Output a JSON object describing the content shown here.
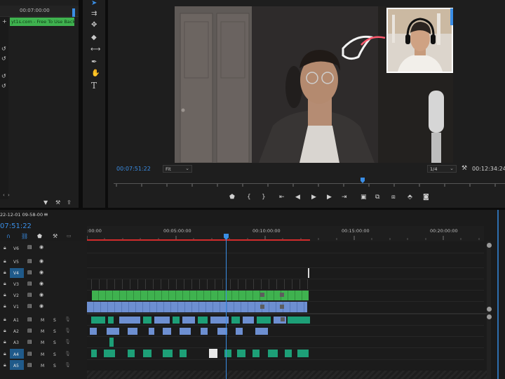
{
  "source_monitor": {
    "timecode": "00:07:00:00",
    "clip_label": "yt1s.com - Free To Use Back"
  },
  "program_monitor": {
    "current_timecode": "00:07:51:22",
    "fit_label": "Fit",
    "resolution_label": "1/4",
    "duration_timecode": "00:12:34:24"
  },
  "timeline": {
    "sequence_name": "22-12-01 09-58-00",
    "menu_icon": "≡",
    "current_timecode": "07:51:22",
    "ruler_labels": [
      ":00:00",
      "00:05:00:00",
      "00:10:00:00",
      "00:15:00:00",
      "00:20:00:00"
    ],
    "video_tracks": [
      "V6",
      "V5",
      "V4",
      "V3",
      "V2",
      "V1"
    ],
    "audio_tracks": [
      "A1",
      "A2",
      "A3",
      "A4",
      "A5"
    ],
    "mute_label": "M",
    "solo_label": "S"
  },
  "colors": {
    "accent_blue": "#3a8ee6",
    "clip_green": "#3fb24f",
    "clip_blue": "#6d8fd1",
    "clip_teal": "#1d9f77",
    "in_out_red": "#d12b2b"
  },
  "icons": {
    "tools": [
      "selection-tool",
      "track-select-tool",
      "ripple-edit-tool",
      "razor-tool",
      "slip-tool",
      "pen-tool",
      "hand-tool",
      "type-tool"
    ],
    "program_controls": [
      "add-marker",
      "mark-in",
      "mark-out",
      "go-to-in",
      "step-back",
      "play",
      "step-forward",
      "go-to-out",
      "insert",
      "overwrite",
      "lift",
      "extract",
      "export-frame",
      "compare"
    ]
  }
}
